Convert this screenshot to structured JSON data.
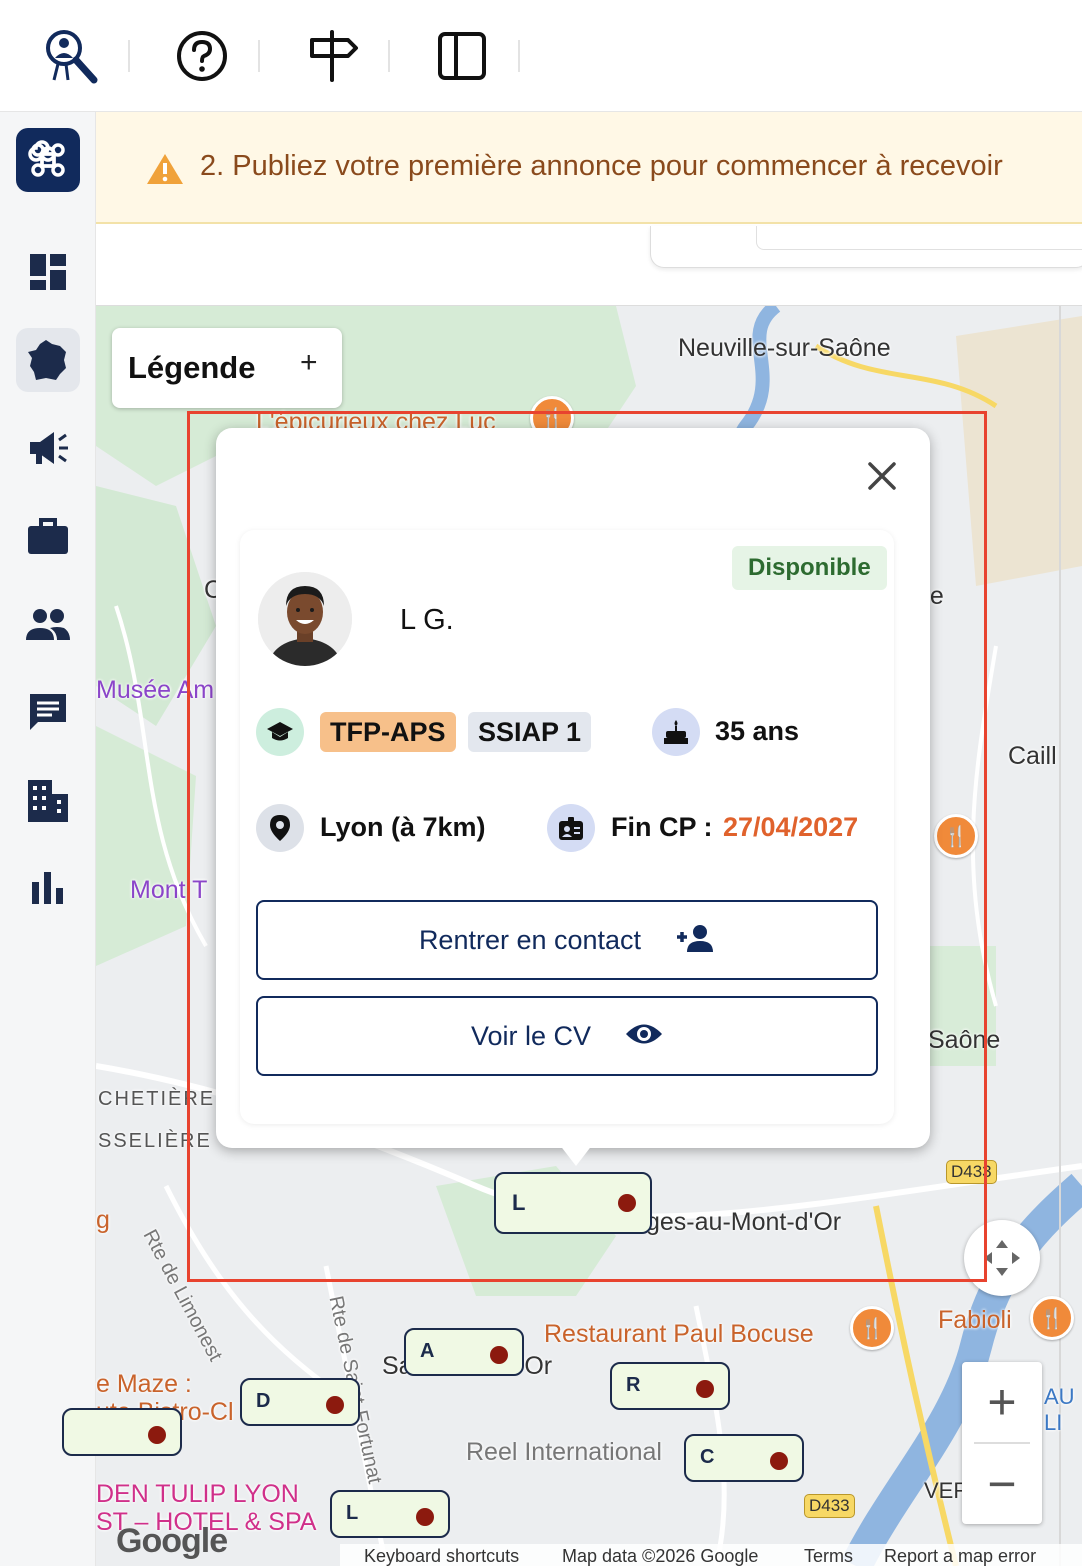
{
  "banner": {
    "text": "2. Publiez votre première annonce pour commencer à recevoir"
  },
  "legend": {
    "title": "Légende",
    "toggle": "+"
  },
  "map": {
    "labels": {
      "neuville": "Neuville-sur-Saône",
      "epicurieux": "L'épicurieux chez Luc",
      "musee": "Musée Am",
      "mont": "Mont T",
      "chetiere": "CHETIÈRE",
      "sseliere": "SSELIÈRE",
      "limonest": "Rte de Limonest",
      "st_fortunat": "Rte de Saint-Fortunat",
      "mont_dor": "ges-au-Mont-d'Or",
      "saint_didier": "Sa    u-Mont-d'Or",
      "paul_bocuse": "Restaurant Paul Bocuse",
      "fabioli": "Fabioli",
      "maze": "e Maze :",
      "maze2": "ute Bistro-Cl",
      "reel": "Reel International",
      "tulip1": "DEN TULIP LYON",
      "tulip2": "ST – HOTEL & SPA",
      "caill": "Caill",
      "sone": "Saône",
      "one": "ne",
      "ver": "VER",
      "au": "AU",
      "li": "LI",
      "g_letter": "g",
      "c_letter": "C",
      "d433_a": "D433",
      "d433_b": "D433"
    },
    "markers": [
      {
        "letter": "L"
      },
      {
        "letter": "A"
      },
      {
        "letter": "D"
      },
      {
        "letter": "R"
      },
      {
        "letter": "C"
      },
      {
        "letter": "L"
      },
      {
        "letter": ""
      }
    ],
    "zoom_in": "+",
    "zoom_out": "−",
    "google": "Google",
    "footer": {
      "shortcuts": "Keyboard shortcuts",
      "data": "Map data ©2026 Google",
      "terms": "Terms",
      "report": "Report a map error"
    }
  },
  "popup": {
    "status": "Disponible",
    "name": "L G.",
    "certifications": [
      "TFP-APS",
      "SSIAP 1"
    ],
    "age": "35 ans",
    "location": "Lyon (à 7km)",
    "fin_cp_label": "Fin CP :",
    "fin_cp_date": "27/04/2027",
    "contact_button": "Rentrer en contact",
    "cv_button": "Voir le CV"
  },
  "colors": {
    "navy": "#112a5c",
    "highlight": "#e8432f",
    "status_green": "#2d6b30",
    "date_orange": "#e0622c",
    "marker_dot": "#8c1a0e"
  },
  "icons": {
    "toolbar": [
      "search-user-icon",
      "help-icon",
      "signpost-icon",
      "sidebar-toggle-icon"
    ],
    "sidebar": [
      "command-icon",
      "dashboard-icon",
      "france-map-icon",
      "megaphone-icon",
      "briefcase-icon",
      "people-icon",
      "chat-icon",
      "building-icon",
      "bar-chart-icon"
    ]
  }
}
